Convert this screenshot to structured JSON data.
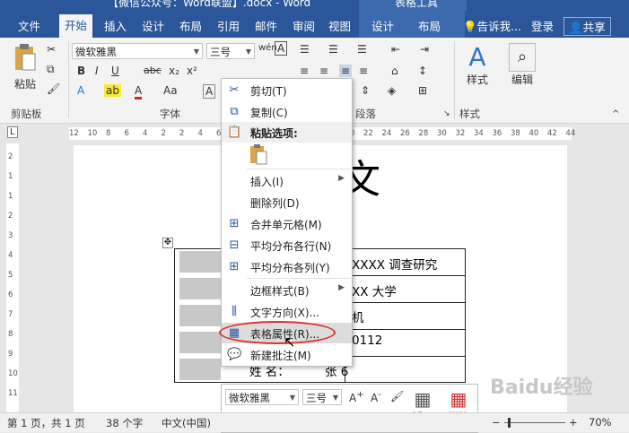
{
  "titlebar": {
    "title": "【微信公众号：Word联盟】.docx - Word",
    "context_title": "表格工具"
  },
  "tabs": [
    {
      "label": "文件"
    },
    {
      "label": "开始"
    },
    {
      "label": "插入"
    },
    {
      "label": "设计"
    },
    {
      "label": "布局"
    },
    {
      "label": "引用"
    },
    {
      "label": "邮件"
    },
    {
      "label": "审阅"
    },
    {
      "label": "视图"
    },
    {
      "label": "设计"
    },
    {
      "label": "布局"
    },
    {
      "label": "告诉我..."
    },
    {
      "label": "登录"
    },
    {
      "label": "共享"
    }
  ],
  "ribbon": {
    "font_name": "微软雅黑",
    "font_size": "三号",
    "paste_label": "粘贴",
    "style_label": "样式",
    "edit_label": "编辑",
    "groups": {
      "clipboard": "剪贴板",
      "font": "字体",
      "paragraph": "段落",
      "styles": "样式"
    },
    "font_buttons": {
      "bold": "B",
      "italic": "I",
      "underline": "U",
      "strike": "abc",
      "sub": "x₂",
      "sup": "x²",
      "aa": "Aa"
    }
  },
  "ruler": {
    "ticks": [
      "12",
      "10",
      "8",
      "6",
      "4",
      "2",
      "2",
      "4",
      "6",
      "8",
      "10",
      "12",
      "14",
      "16",
      "18",
      "20",
      "22",
      "24",
      "26",
      "28",
      "30",
      "32",
      "34",
      "36",
      "38",
      "40",
      "42",
      "44"
    ],
    "vticks": [
      "2",
      "1",
      "1",
      "2",
      "3",
      "4",
      "5",
      "6",
      "7",
      "8",
      "9",
      "10",
      "11"
    ]
  },
  "document": {
    "title_fragment": "文",
    "table_rows": [
      "XXXX 调查研究",
      "XX 大学",
      "机",
      "0112",
      "张 6"
    ],
    "last_row_label": "姓    名："
  },
  "context_menu": {
    "items": [
      {
        "label": "剪切(T)",
        "icon": "scissors-icon"
      },
      {
        "label": "复制(C)",
        "icon": "copy-icon"
      },
      {
        "label": "粘贴选项:",
        "icon": "paste-icon"
      },
      {
        "label": "插入(I)",
        "icon": ""
      },
      {
        "label": "删除列(D)",
        "icon": ""
      },
      {
        "label": "合并单元格(M)",
        "icon": "merge-cells-icon"
      },
      {
        "label": "平均分布各行(N)",
        "icon": "distribute-rows-icon"
      },
      {
        "label": "平均分布各列(Y)",
        "icon": "distribute-columns-icon"
      },
      {
        "label": "边框样式(B)",
        "icon": ""
      },
      {
        "label": "文字方向(X)...",
        "icon": "text-direction-icon"
      },
      {
        "label": "表格属性(R)...",
        "icon": "table-properties-icon"
      },
      {
        "label": "新建批注(M)",
        "icon": "new-comment-icon"
      }
    ]
  },
  "minibar": {
    "font_name": "微软雅黑",
    "font_size": "三号",
    "insert_label": "插入",
    "delete_label": "删除"
  },
  "status": {
    "page": "第 1 页，共 1 页",
    "words": "38 个字",
    "language": "中文(中国)",
    "zoom": "70%"
  },
  "watermark": "Baidu经验"
}
